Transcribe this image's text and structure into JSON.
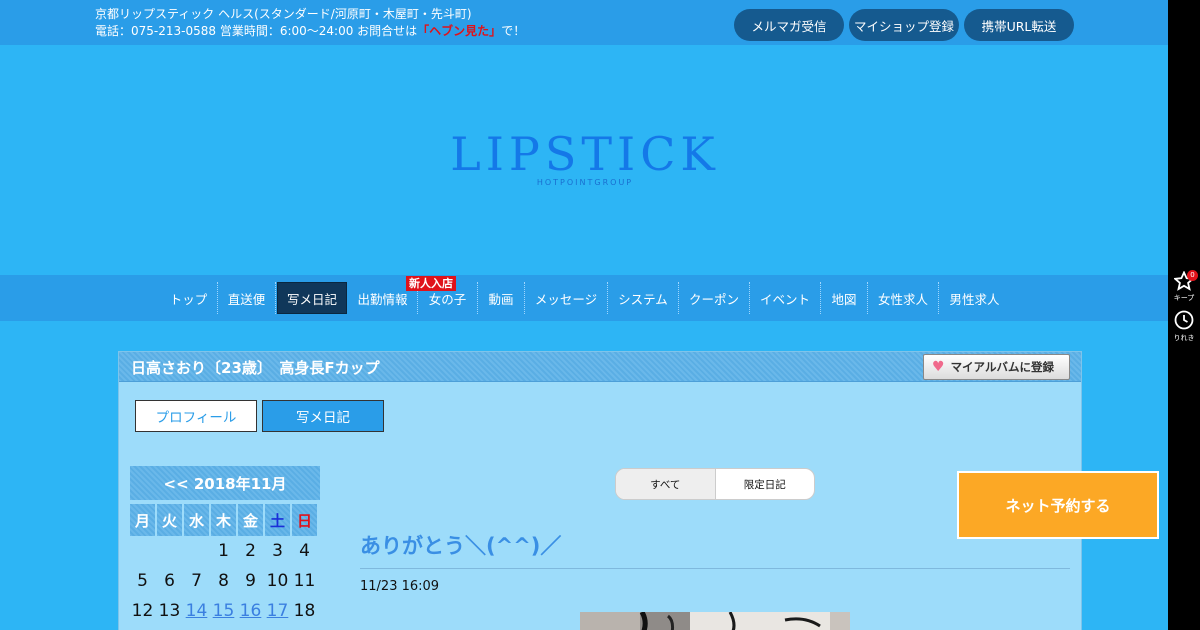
{
  "header": {
    "line1": "京都リップスティック ヘルス(スタンダード/河原町・木屋町・先斗町)",
    "line2_prefix": "電話：075-213-0588 営業時間：6:00～24:00 お問合せは",
    "line2_highlight": "「ヘブン見た」",
    "line2_suffix": "で！",
    "buttons": [
      "メルマガ受信",
      "マイショップ登録",
      "携帯URL転送"
    ]
  },
  "sidebar": {
    "keep_label": "キープ",
    "keep_count": "0",
    "history_label": "りれき"
  },
  "logo": {
    "main": "LIPSTICK",
    "sub": "HOTPOINTGROUP"
  },
  "nav": {
    "items": [
      "トップ",
      "直送便",
      "写メ日記",
      "出勤情報",
      "女の子",
      "動画",
      "メッセージ",
      "システム",
      "クーポン",
      "イベント",
      "地図",
      "女性求人",
      "男性求人"
    ],
    "active": "写メ日記",
    "new_badge": "新人入店"
  },
  "profile": {
    "title": "日高さおり〔23歳〕　高身長Fカップ",
    "album_button": "マイアルバムに登録",
    "tabs": [
      "プロフィール",
      "写メ日記"
    ]
  },
  "calendar": {
    "header": "<< 2018年11月",
    "weekdays": [
      "月",
      "火",
      "水",
      "木",
      "金",
      "土",
      "日"
    ],
    "days": [
      {
        "d": "1",
        "link": false
      },
      {
        "d": "2",
        "link": false
      },
      {
        "d": "3",
        "link": false
      },
      {
        "d": "4",
        "link": false
      },
      {
        "d": "5",
        "link": false
      },
      {
        "d": "6",
        "link": false
      },
      {
        "d": "7",
        "link": false
      },
      {
        "d": "8",
        "link": false
      },
      {
        "d": "9",
        "link": false
      },
      {
        "d": "10",
        "link": false
      },
      {
        "d": "11",
        "link": false
      },
      {
        "d": "12",
        "link": false
      },
      {
        "d": "13",
        "link": false
      },
      {
        "d": "14",
        "link": true
      },
      {
        "d": "15",
        "link": true
      },
      {
        "d": "16",
        "link": true
      },
      {
        "d": "17",
        "link": true
      },
      {
        "d": "18",
        "link": false
      }
    ]
  },
  "diary": {
    "filters": [
      "すべて",
      "限定日記"
    ],
    "post_title": "ありがとう＼(^^)／",
    "post_date": "11/23 16:09"
  },
  "reserve_button": "ネット予約する"
}
